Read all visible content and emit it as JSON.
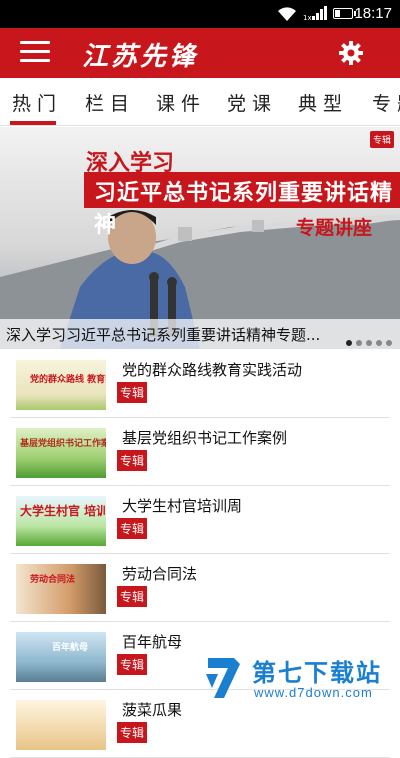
{
  "status_bar": {
    "time": "18:17",
    "network": "1x"
  },
  "app": {
    "title": "江苏先锋"
  },
  "tabs": [
    {
      "label": "热门",
      "active": true
    },
    {
      "label": "栏目",
      "active": false
    },
    {
      "label": "课件",
      "active": false
    },
    {
      "label": "党课",
      "active": false
    },
    {
      "label": "典型",
      "active": false
    },
    {
      "label": "专题",
      "active": false
    }
  ],
  "banner": {
    "tag": "专辑",
    "line1": "深入学习",
    "line2": "习近平总书记系列重要讲话精神",
    "line3": "专题讲座",
    "caption": "深入学习习近平总书记系列重要讲话精神专题...",
    "page_count": 5,
    "current_page": 1
  },
  "list": [
    {
      "title": "党的群众路线教育实践活动",
      "tag": "专辑",
      "thumb_text": "党的群众路线 教育实践活动"
    },
    {
      "title": "基层党组织书记工作案例",
      "tag": "专辑",
      "thumb_text": "基层党组织书记工作案例"
    },
    {
      "title": "大学生村官培训周",
      "tag": "专辑",
      "thumb_text": "大学生村官 培训"
    },
    {
      "title": "劳动合同法",
      "tag": "专辑",
      "thumb_text": "劳动合同法"
    },
    {
      "title": "百年航母",
      "tag": "专辑",
      "thumb_text": "百年航母"
    },
    {
      "title": "菠菜瓜果",
      "tag": "专辑",
      "thumb_text": ""
    }
  ],
  "watermark": {
    "name": "第七下载站",
    "url": "www.d7down.com"
  },
  "colors": {
    "brand": "#c8161d",
    "watermark": "#1b7fd0"
  }
}
